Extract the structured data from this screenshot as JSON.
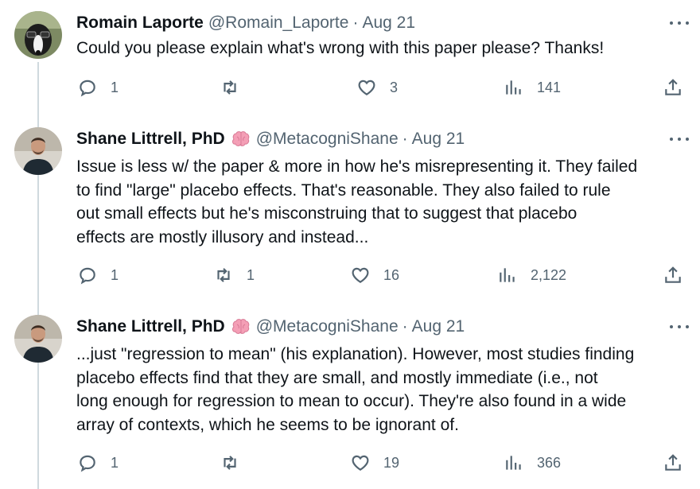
{
  "tweets": [
    {
      "name": "Romain Laporte",
      "handle": "@Romain_Laporte",
      "separator": "·",
      "date": "Aug 21",
      "text": "Could you please explain what's wrong with this paper please? Thanks!",
      "replies": "1",
      "retweets": "",
      "likes": "3",
      "views": "141"
    },
    {
      "name": "Shane Littrell, PhD",
      "handle": "@MetacogniShane",
      "separator": "·",
      "date": "Aug 21",
      "text": "Issue is less w/ the paper & more in how he's misrepresenting it. They failed\nto find \"large\" placebo effects. That's reasonable. They also failed to rule\nout small effects but he's misconstruing that to suggest that placebo\neffects are mostly illusory and instead...",
      "replies": "1",
      "retweets": "1",
      "likes": "16",
      "views": "2,122"
    },
    {
      "name": "Shane Littrell, PhD",
      "handle": "@MetacogniShane",
      "separator": "·",
      "date": "Aug 21",
      "text": "...just \"regression to mean\" (his explanation). However, most studies finding\nplacebo effects find that they are small, and mostly immediate (i.e., not\nlong enough for regression to mean to occur). They're also found in a wide\narray of contexts, which he seems to be ignorant of.",
      "replies": "1",
      "retweets": "",
      "likes": "19",
      "views": "366"
    }
  ],
  "icons": {
    "reply": "speech-bubble-icon",
    "retweet": "retweet-arrows-icon",
    "like": "heart-icon",
    "views": "bar-chart-icon",
    "share": "share-upload-icon",
    "more": "ellipsis-icon",
    "verified_emoji": "brain-emoji-icon"
  },
  "colors": {
    "text_primary": "#0f1419",
    "text_secondary": "#536471",
    "thread_line": "#cfd9de",
    "brain_emoji": "#f49fb6"
  }
}
